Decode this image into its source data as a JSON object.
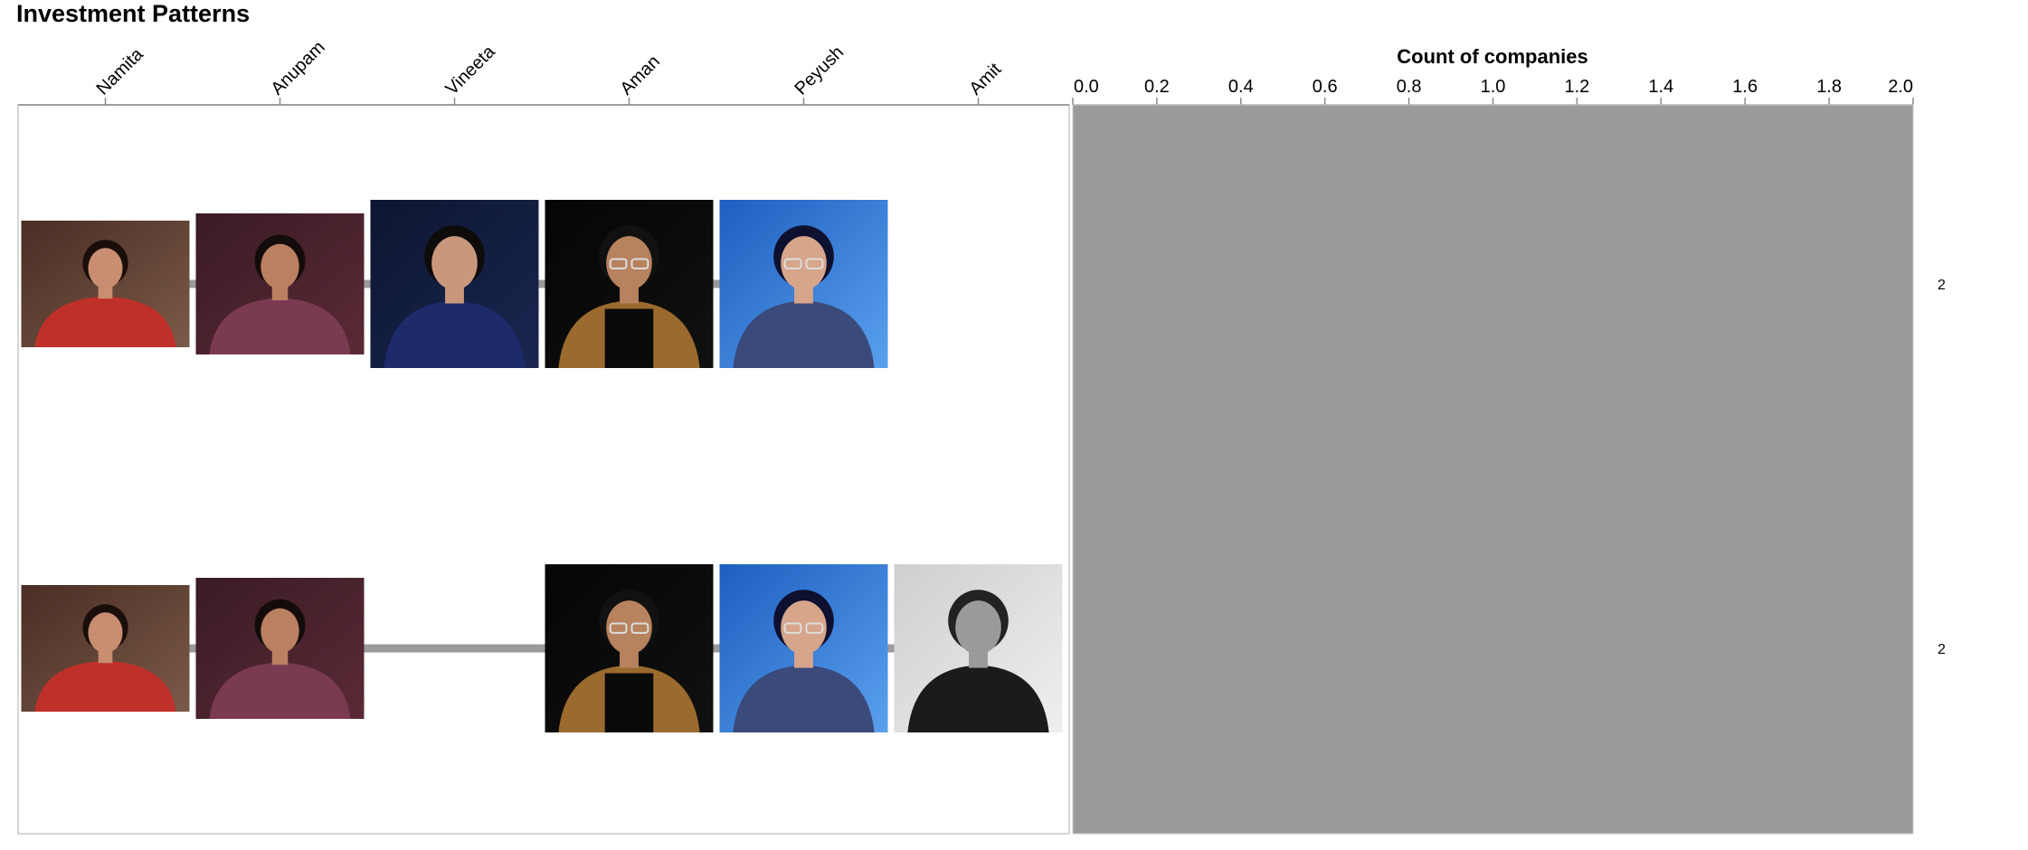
{
  "page": {
    "title": "Investment Patterns"
  },
  "chart_data": {
    "type": "upset",
    "investors": [
      "Namita",
      "Anupam",
      "Vineeta",
      "Aman",
      "Peyush",
      "Amit"
    ],
    "bar_axis": {
      "title": "Count of companies",
      "domain": [
        0,
        2
      ],
      "ticks": [
        "0.0",
        "0.2",
        "0.4",
        "0.6",
        "0.8",
        "1.0",
        "1.2",
        "1.4",
        "1.6",
        "1.8",
        "2.0"
      ]
    },
    "combinations": [
      {
        "members": [
          "Namita",
          "Anupam",
          "Vineeta",
          "Aman",
          "Peyush"
        ],
        "count": 2,
        "count_label": "2"
      },
      {
        "members": [
          "Namita",
          "Anupam",
          "Aman",
          "Peyush",
          "Amit"
        ],
        "count": 2,
        "count_label": "2"
      }
    ],
    "portrait_icons": {
      "Namita": "portrait-red-blazer-woman",
      "Anupam": "portrait-patterned-suit-man",
      "Vineeta": "portrait-navy-blazer-woman",
      "Aman": "portrait-boat-tshirt-man",
      "Peyush": "portrait-glasses-blue-background-man",
      "Amit": "portrait-bw-suit-man"
    },
    "colors": {
      "bar": "#9a9a9a",
      "connector": "#9a9a9a",
      "frame": "#c8c8c8"
    }
  }
}
